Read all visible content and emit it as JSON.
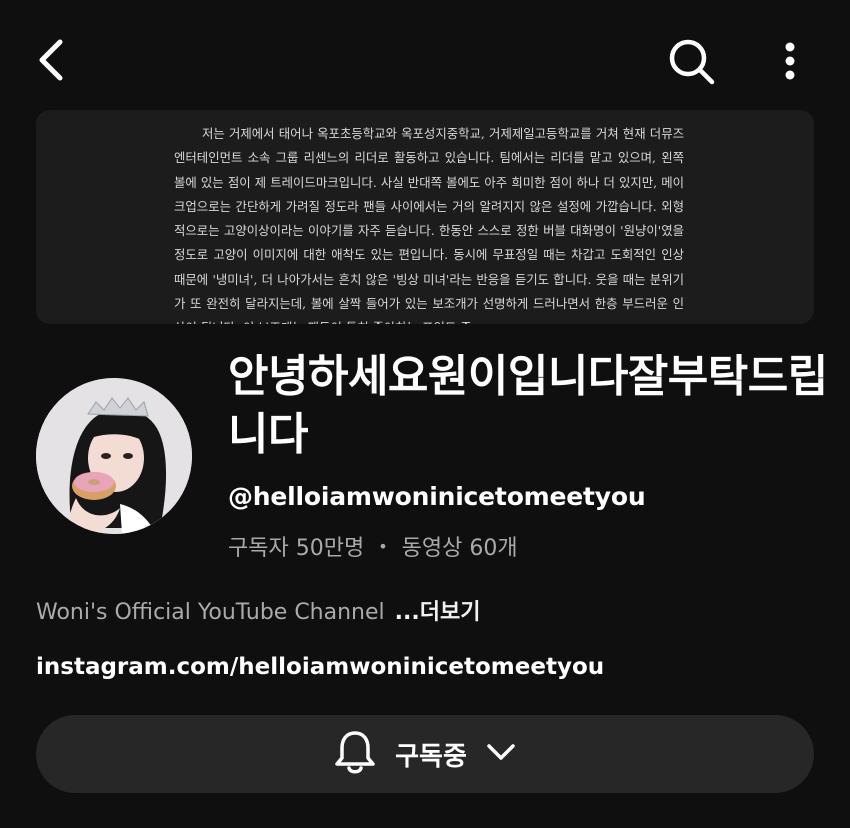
{
  "header": {
    "back_icon": "back-arrow-icon",
    "search_icon": "search-icon",
    "more_icon": "more-vert-icon"
  },
  "banner": {
    "text": "저는 거제에서 태어나 옥포초등학교와 옥포성지중학교, 거제제일고등학교를 거쳐 현재 더뮤즈 엔터테인먼트 소속 그룹 리센느의 리더로 활동하고 있습니다. 팀에서는 리더를 맡고 있으며, 왼쪽 볼에 있는 점이 제 트레이드마크입니다. 사실 반대쪽 볼에도 아주 희미한 점이 하나 더 있지만, 메이크업으로는 간단하게 가려질 정도라 팬들 사이에서는 거의 알려지지 않은 설정에 가깝습니다. 외형적으로는 고양이상이라는 이야기를 자주 듣습니다. 한동안 스스로 정한 버블 대화명이 '원냥이'였을 정도로 고양이 이미지에 대한 애착도 있는 편입니다. 동시에 무표정일 때는 차갑고 도회적인 인상 때문에 '냉미녀', 더 나아가서는 흔치 않은 '빙상 미녀'라는 반응을 듣기도 합니다. 웃을 때는 분위기가 또 완전히 달라지는데, 볼에 살짝 들어가 있는 보조개가 선명하게 드러나면서 한층 부드러운 인상이 됩니다. 이 보조개는 팬들이 특히 좋아하는 포인트 중"
  },
  "channel": {
    "name": "안녕하세요원이입니다잘부탁드립니다",
    "handle": "@helloiamwoninicetomeetyou",
    "subscribers": "구독자 50만명",
    "separator": "•",
    "videos": "동영상 60개",
    "description": "Woni's Official YouTube Channel",
    "more_label": "...더보기",
    "link": "instagram.com/helloiamwoninicetomeetyou"
  },
  "subscribe": {
    "label": "구독중",
    "bell_icon": "bell-icon",
    "chevron_icon": "chevron-down-icon"
  },
  "colors": {
    "background": "#0f0f0f",
    "surface": "#272727",
    "secondary_text": "#aaaaaa",
    "primary_text": "#ffffff"
  }
}
